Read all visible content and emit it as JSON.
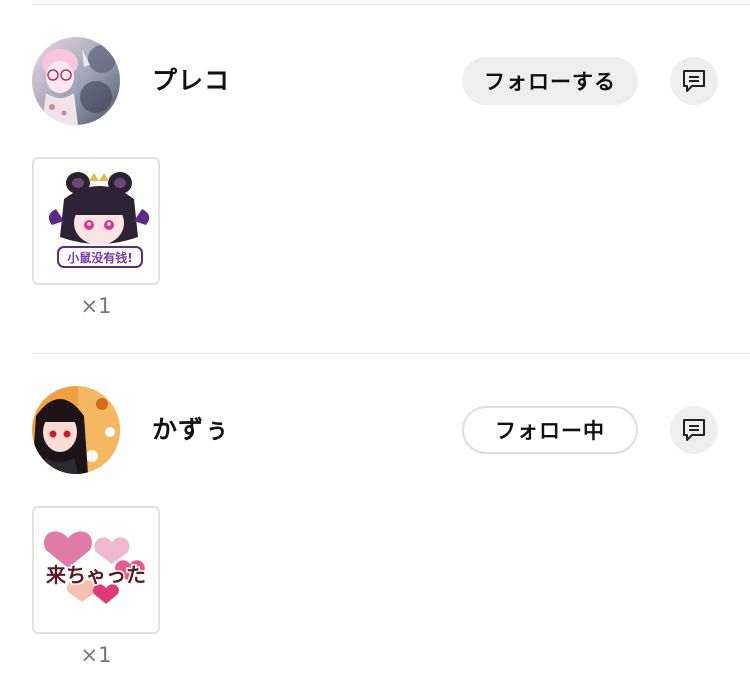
{
  "entries": [
    {
      "username": "プレコ",
      "follow_label": "フォローする",
      "follow_state": "not-following",
      "gift_count": "×1",
      "gift_sticker_text": "小鼠没有钱!",
      "avatar_icon": "user-avatar-icon",
      "message_icon": "message-icon"
    },
    {
      "username": "かずぅ",
      "follow_label": "フォロー中",
      "follow_state": "following",
      "gift_count": "×1",
      "gift_sticker_text": "来ちゃった",
      "avatar_icon": "user-avatar-icon",
      "message_icon": "message-icon"
    }
  ],
  "colors": {
    "button_gray": "#eeeeee",
    "outline_gray": "#dedede",
    "divider": "#e8e8e8",
    "count_text": "#777777"
  }
}
